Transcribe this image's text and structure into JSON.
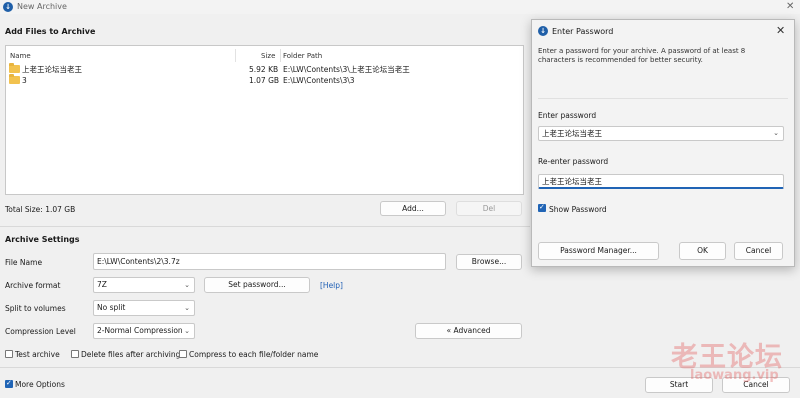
{
  "window": {
    "title": "New Archive",
    "icon": "app-logo-icon"
  },
  "files": {
    "section_title": "Add Files to Archive",
    "columns": {
      "name": "Name",
      "size": "Size",
      "folder": "Folder Path"
    },
    "rows": [
      {
        "name": "上老王论坛当老王",
        "size": "5.92 KB",
        "path": "E:\\LW\\Contents\\3\\上老王论坛当老王"
      },
      {
        "name": "3",
        "size": "1.07 GB",
        "path": "E:\\LW\\Contents\\3\\3"
      }
    ],
    "total_size": "Total Size: 1.07 GB",
    "add_label": "Add...",
    "del_label": "Del"
  },
  "settings": {
    "section_title": "Archive Settings",
    "file_name_label": "File Name",
    "file_name_value": "E:\\LW\\Contents\\2\\3.7z",
    "browse_label": "Browse...",
    "format_label": "Archive format",
    "format_value": "7Z",
    "set_password_label": "Set password...",
    "help_label": "[Help]",
    "split_label": "Split to volumes",
    "split_value": "No split",
    "compression_label": "Compression Level",
    "compression_value": "2-Normal Compression",
    "advanced_label": "« Advanced",
    "test_archive_label": "Test archive",
    "delete_files_label": "Delete files after archiving",
    "compress_each_label": "Compress to each file/folder name"
  },
  "footer": {
    "more_options_label": "More Options",
    "start_label": "Start",
    "cancel_label": "Cancel"
  },
  "dialog": {
    "title": "Enter Password",
    "description": "Enter a password for your archive. A password of at least 8 characters is recommended for better security.",
    "enter_label": "Enter password",
    "enter_value": "上老王论坛当老王",
    "reenter_label": "Re-enter password",
    "reenter_value": "上老王论坛当老王",
    "show_password_label": "Show Password",
    "password_manager_label": "Password Manager...",
    "ok_label": "OK",
    "cancel_label": "Cancel"
  },
  "watermark": {
    "line1": "老王论坛",
    "line2": "laowang.vip"
  },
  "colors": {
    "accent": "#2064b5",
    "link": "#1f5fb5",
    "watermark": "#e25d5d"
  }
}
